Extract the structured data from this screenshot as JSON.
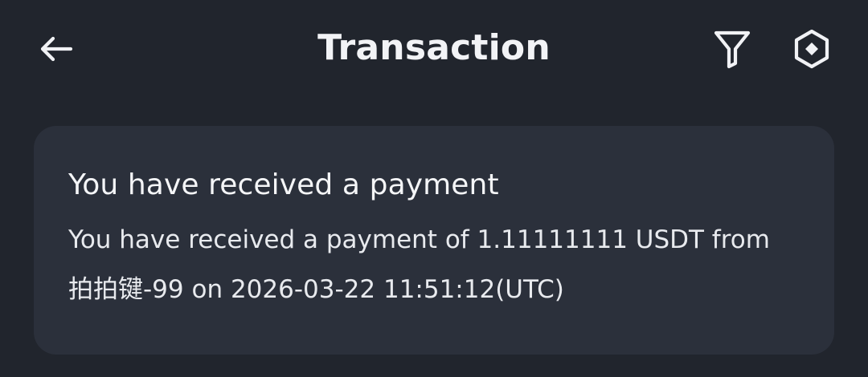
{
  "header": {
    "title": "Transaction",
    "back_icon": "arrow-left-icon",
    "filter_icon": "filter-icon",
    "settings_icon": "hexagon-settings-icon"
  },
  "notification": {
    "title": "You have received a payment",
    "message": "You have received a payment of 1.11111111 USDT from 拍拍键-99 on 2026-03-22 11:51:12(UTC)"
  },
  "colors": {
    "background": "#21252d",
    "card": "#2b303b",
    "text": "#f1f2f5"
  }
}
